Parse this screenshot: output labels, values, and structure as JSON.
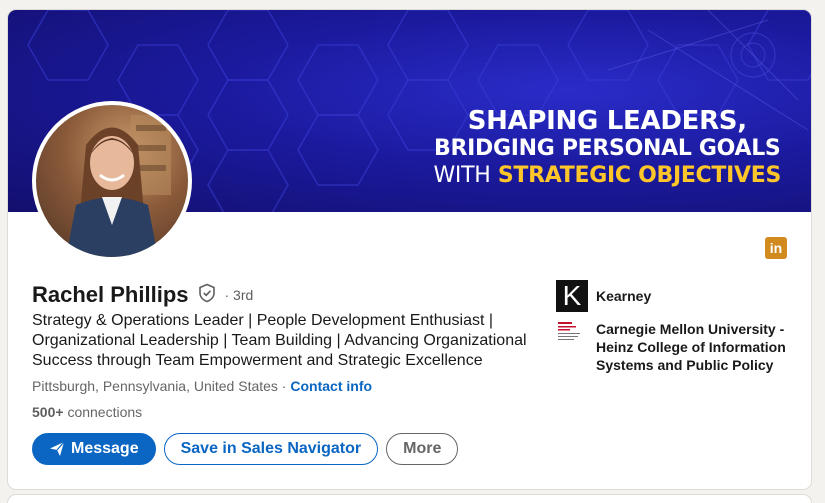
{
  "banner": {
    "line1": "SHAPING LEADERS,",
    "line2": "BRIDGING PERSONAL GOALS",
    "line3_plain": "WITH",
    "line3_accent": "STRATEGIC OBJECTIVES",
    "accent_color": "#ffc629",
    "background_color": "#1b1a9e"
  },
  "profile": {
    "name": "Rachel Phillips",
    "degree": "· 3rd",
    "headline": "Strategy & Operations Leader | People Development Enthusiast | Organizational Leadership | Team Building | Advancing Organizational Success through Team Empowerment and Strategic Excellence",
    "location": "Pittsburgh, Pennsylvania, United States",
    "location_separator": " · ",
    "contact_info": "Contact info",
    "connections_count": "500+",
    "connections_label": "connections"
  },
  "actions": {
    "message": "Message",
    "save_sales_navigator": "Save in Sales Navigator",
    "more": "More"
  },
  "affiliations": [
    {
      "name": "Kearney",
      "logo_letter": "K"
    },
    {
      "name": "Carnegie Mellon University - Heinz College of Information Systems and Public Policy"
    }
  ],
  "icons": {
    "verify": "verified-shield-icon",
    "linkedin": "linkedin-icon",
    "message": "paper-plane-icon"
  },
  "colors": {
    "primary": "#0a66c2",
    "linkedin_badge": "#d08a1e"
  }
}
